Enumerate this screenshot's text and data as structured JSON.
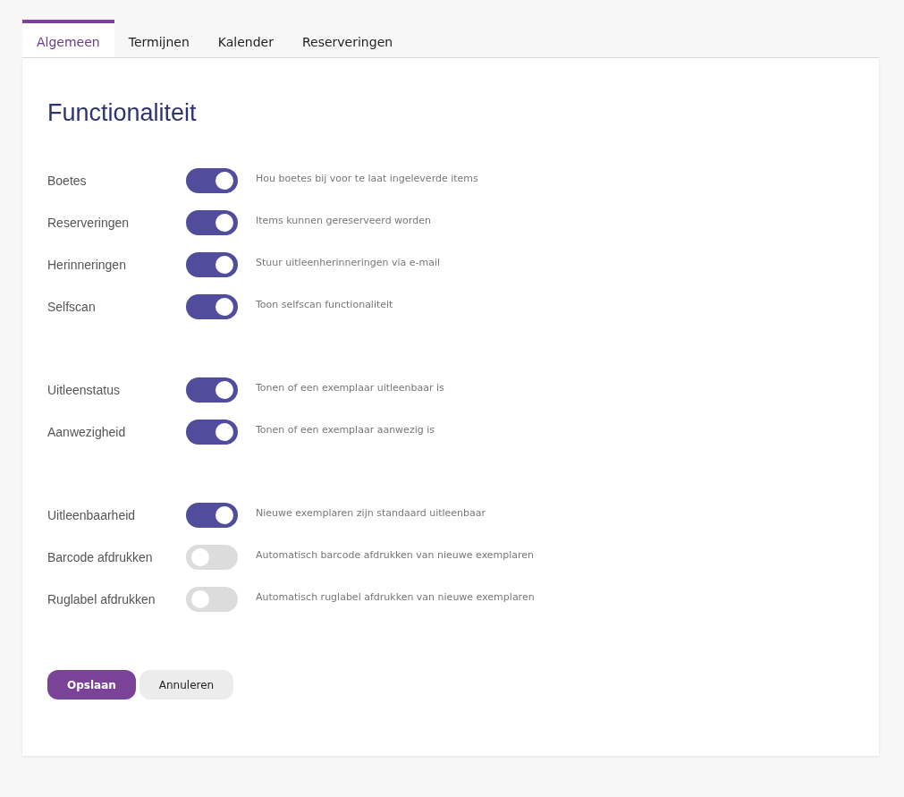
{
  "tabs": [
    {
      "label": "Algemeen",
      "selected": true
    },
    {
      "label": "Termijnen",
      "selected": false
    },
    {
      "label": "Kalender",
      "selected": false
    },
    {
      "label": "Reserveringen",
      "selected": false
    }
  ],
  "section_title": "Functionaliteit",
  "groups": [
    {
      "settings": [
        {
          "label": "Boetes",
          "on": true,
          "description": "Hou boetes bij voor te laat ingeleverde items"
        },
        {
          "label": "Reserveringen",
          "on": true,
          "description": "Items kunnen gereserveerd worden"
        },
        {
          "label": "Herinneringen",
          "on": true,
          "description": "Stuur uitleenherinneringen via e-mail"
        },
        {
          "label": "Selfscan",
          "on": true,
          "description": "Toon selfscan functionaliteit"
        }
      ]
    },
    {
      "settings": [
        {
          "label": "Uitleenstatus",
          "on": true,
          "description": "Tonen of een exemplaar uitleenbaar is"
        },
        {
          "label": "Aanwezigheid",
          "on": true,
          "description": "Tonen of een exemplaar aanwezig is"
        }
      ]
    },
    {
      "settings": [
        {
          "label": "Uitleenbaarheid",
          "on": true,
          "description": "Nieuwe exemplaren zijn standaard uitleenbaar"
        },
        {
          "label": "Barcode afdrukken",
          "on": false,
          "description": "Automatisch barcode afdrukken van nieuwe exemplaren"
        },
        {
          "label": "Ruglabel afdrukken",
          "on": false,
          "description": "Automatisch ruglabel afdrukken van nieuwe exemplaren"
        }
      ]
    }
  ],
  "buttons": [
    {
      "label": "Opslaan",
      "kind": "primary"
    },
    {
      "label": "Annuleren",
      "kind": "secondary"
    }
  ]
}
